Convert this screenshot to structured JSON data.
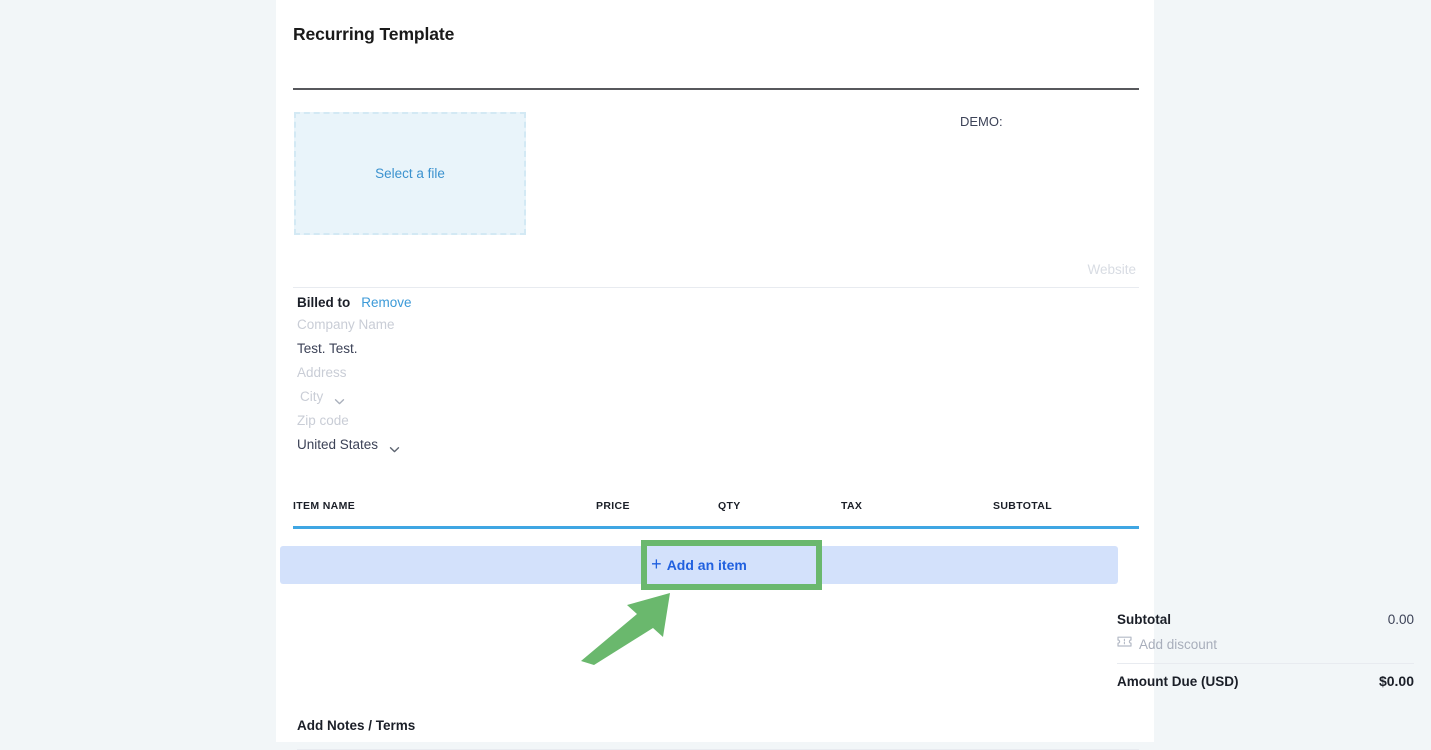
{
  "page": {
    "background_color": "#f2f6f8",
    "card_background": "#ffffff"
  },
  "document": {
    "title": "Recurring Template"
  },
  "logo_upload": {
    "label": "Select a file",
    "icon": "dropzone-icon"
  },
  "header_right": {
    "demo_label": "DEMO:",
    "website_placeholder": "Website"
  },
  "billed_to": {
    "heading": "Billed to",
    "remove_label": "Remove",
    "company_name_placeholder": "Company Name",
    "contact_name_value": "Test. Test.",
    "address_placeholder": "Address",
    "city_placeholder": "City",
    "zip_placeholder": "Zip code",
    "country_value": "United States",
    "caret_icon": "chevron-down-icon"
  },
  "items_table": {
    "columns": [
      "ITEM NAME",
      "PRICE",
      "QTY",
      "TAX",
      "SUBTOTAL"
    ],
    "rows": [],
    "add_item_label": "Add an item",
    "add_item_icon": "plus-icon",
    "header_rule_color": "#3fa6e3",
    "row_band_color": "#d3e1fb"
  },
  "annotation": {
    "color": "#6ab86d",
    "type": "highlight-box-and-arrow",
    "target": "add-an-item-button"
  },
  "totals": {
    "subtotal_label": "Subtotal",
    "subtotal_value": "0.00",
    "add_discount_label": "Add discount",
    "discount_icon": "ticket-icon",
    "amount_due_label": "Amount Due (USD)",
    "amount_due_value": "$0.00"
  },
  "notes": {
    "label": "Add Notes / Terms"
  }
}
